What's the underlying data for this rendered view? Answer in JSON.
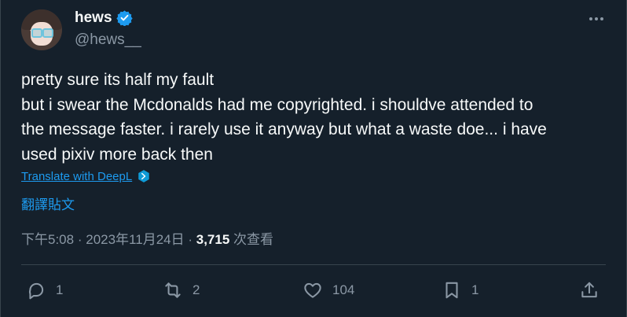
{
  "author": {
    "display_name": "hews",
    "handle": "@hews__",
    "verified": true
  },
  "tweet": {
    "text_lines": [
      "pretty sure its half my fault",
      "but i swear the Mcdonalds had me copyrighted. i shouldve attended to",
      "the message faster. i rarely use it anyway but what a waste doe... i have",
      "used pixiv more back then"
    ],
    "translate_label": "Translate with DeepL",
    "translate_label_zh": "翻譯貼文"
  },
  "meta": {
    "time": "下午5:08",
    "date": "2023年11月24日",
    "views_count": "3,715",
    "views_label": "次查看",
    "separator": "·"
  },
  "actions": {
    "reply_count": "1",
    "retweet_count": "2",
    "like_count": "104",
    "bookmark_count": "1"
  },
  "colors": {
    "background": "#15202b",
    "text": "#f7f9f9",
    "secondary": "#8b98a5",
    "accent": "#1d9bf0"
  },
  "icons": [
    "more-icon",
    "verified-badge-icon",
    "deepl-icon",
    "reply-icon",
    "retweet-icon",
    "like-icon",
    "bookmark-icon",
    "share-icon"
  ]
}
